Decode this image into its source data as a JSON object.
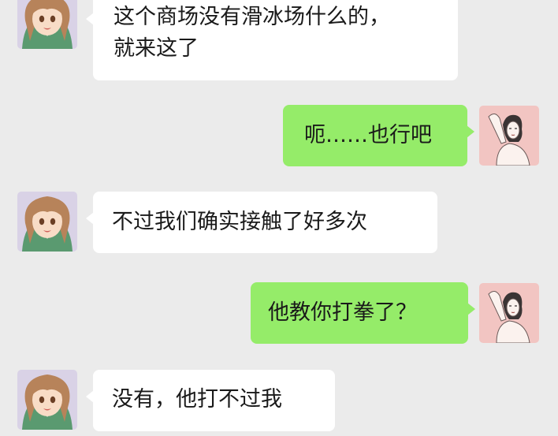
{
  "messages": [
    {
      "side": "left",
      "sender": "girl",
      "lines": [
        "这个商场没有滑冰场什么的，",
        "就来这了"
      ]
    },
    {
      "side": "right",
      "sender": "woman",
      "lines": [
        "呃……也行吧"
      ]
    },
    {
      "side": "left",
      "sender": "girl",
      "lines": [
        "不过我们确实接触了好多次"
      ]
    },
    {
      "side": "right",
      "sender": "woman",
      "lines": [
        "他教你打拳了？"
      ]
    },
    {
      "side": "left",
      "sender": "girl",
      "lines": [
        "没有，他打不过我"
      ]
    }
  ],
  "colors": {
    "background": "#ebebeb",
    "bubble_left": "#ffffff",
    "bubble_right": "#95ec69",
    "text": "#1a1a1a"
  },
  "icons": {
    "left_avatar": "anime-girl-avatar",
    "right_avatar": "sketched-woman-avatar"
  }
}
